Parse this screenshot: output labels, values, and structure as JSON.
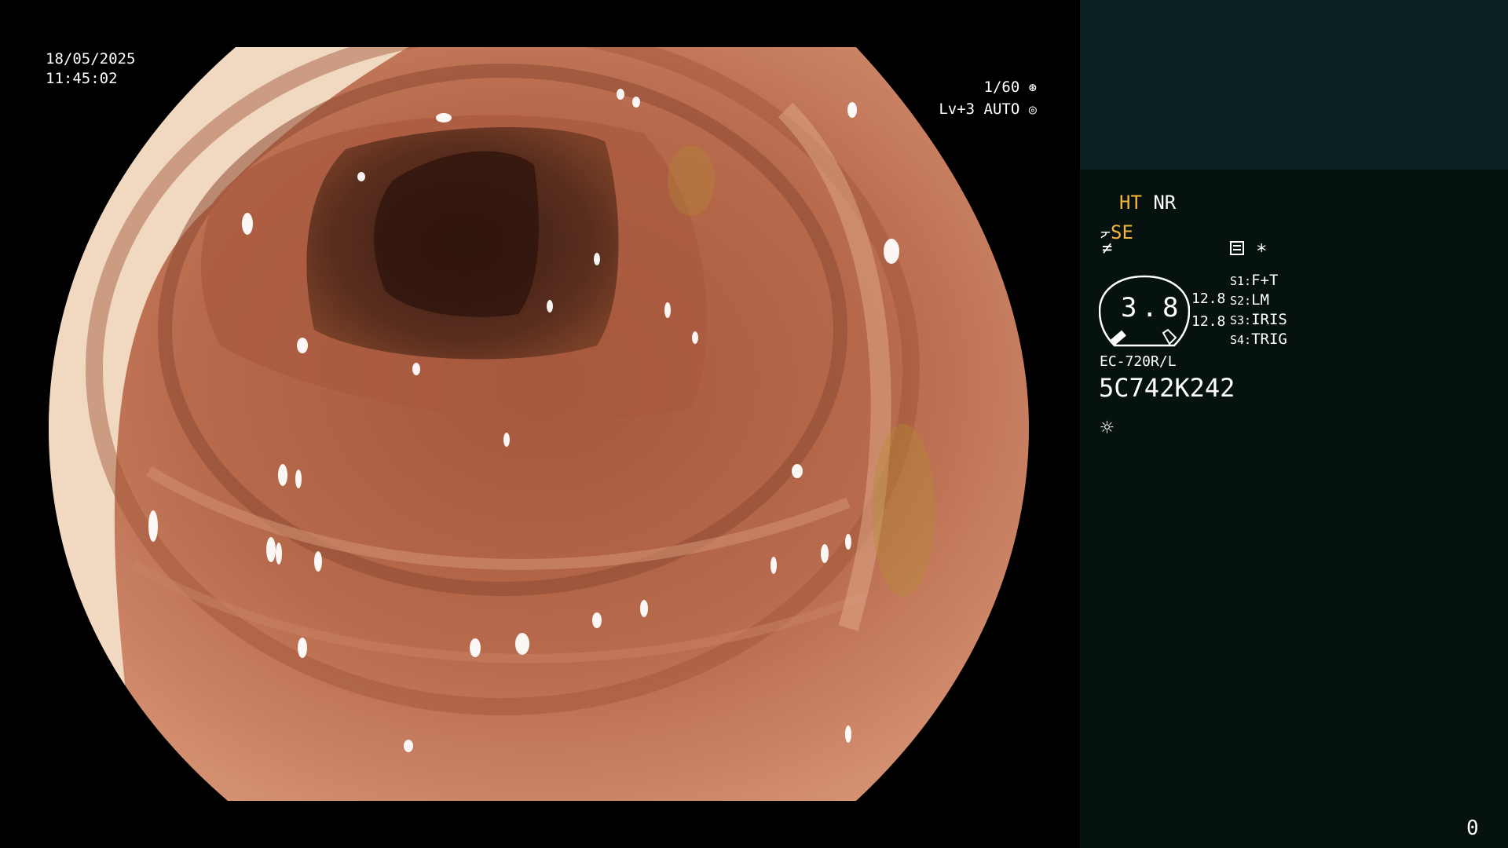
{
  "osd": {
    "date": "18/05/2025",
    "time": "11:45:02",
    "shutter": "1/60",
    "level": "Lv+3",
    "exposure_mode": "AUTO"
  },
  "panel": {
    "ht_label": "HT",
    "nr_label": "NR",
    "se_label": "SE",
    "zoom_value": "3.8",
    "left_value_1": "12.8",
    "left_value_2": "12.8",
    "switches": [
      {
        "key": "S1:",
        "value": "F+T"
      },
      {
        "key": "S2:",
        "value": "LM"
      },
      {
        "key": "S3:",
        "value": "IRIS"
      },
      {
        "key": "S4:",
        "value": "TRIG"
      }
    ],
    "scope_model": "EC-720R/L",
    "serial": "5C742K242",
    "asterisk": "*",
    "counter": "0"
  },
  "colors": {
    "amber": "#f5b53b",
    "panel_top": "#0c2222",
    "panel_bottom": "#061210",
    "tissue": "#b86a4c"
  },
  "icons": [
    "shutter-icon",
    "auto-iris-icon",
    "structure-enhance-icon",
    "color-mode-icon",
    "memo-icon",
    "lamp-icon"
  ]
}
